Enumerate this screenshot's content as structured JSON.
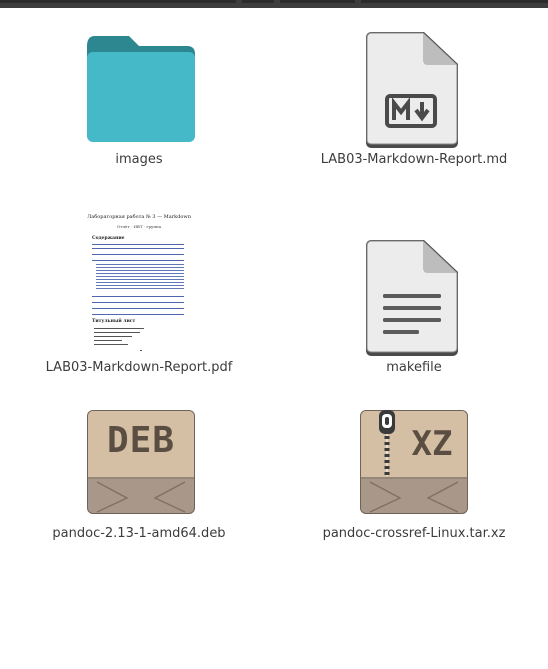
{
  "files": [
    {
      "name": "images",
      "type": "folder"
    },
    {
      "name": "LAB03-Markdown-Report.md",
      "type": "markdown"
    },
    {
      "name": "LAB03-Markdown-Report.pdf",
      "type": "pdf"
    },
    {
      "name": "makefile",
      "type": "text"
    },
    {
      "name": "pandoc-2.13-1-amd64.deb",
      "type": "deb-package",
      "badge": "DEB"
    },
    {
      "name": "pandoc-crossref-Linux.tar.xz",
      "type": "archive",
      "badge": "XZ"
    }
  ],
  "pdf_preview": {
    "title": "Лабораторная работа № 3 — Markdown",
    "subtitle": "Отчёт · ИВТ · группа",
    "toc_heading": "Содержание",
    "section_heading": "Титульный лист"
  },
  "colors": {
    "folder": "#46b9c9",
    "folder_tab": "#2c8790",
    "doc_page": "#ececec",
    "doc_ink": "#4a4a4a",
    "package_top": "#d4bfa5",
    "package_bottom": "#a9988a",
    "label_text": "#3c3c3c"
  },
  "icons": {
    "folder": "folder-icon",
    "markdown": "markdown-file-icon",
    "pdf": "pdf-thumbnail",
    "text": "text-file-icon",
    "deb": "deb-package-icon",
    "archive": "archive-zip-icon"
  }
}
